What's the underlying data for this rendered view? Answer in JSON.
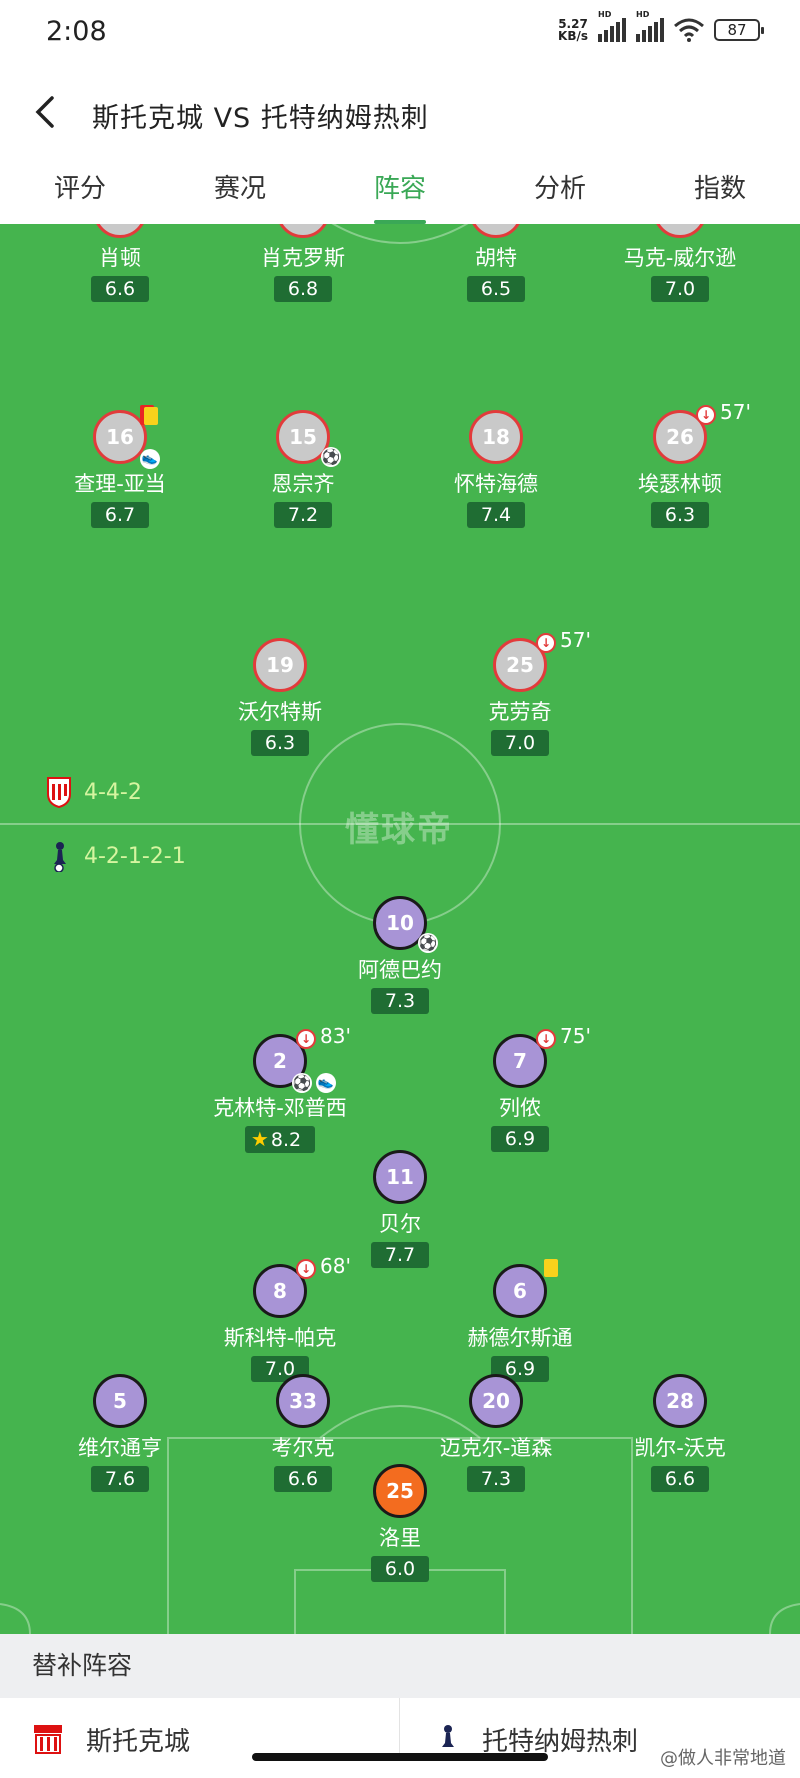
{
  "status": {
    "time": "2:08",
    "speed_value": "5.27",
    "speed_unit": "KB/s",
    "net1": "HD",
    "net2": "HD",
    "battery": "87"
  },
  "header": {
    "title": "斯托克城 VS 托特纳姆热刺"
  },
  "tabs": [
    {
      "label": "评分"
    },
    {
      "label": "赛况"
    },
    {
      "label": "阵容"
    },
    {
      "label": "分析"
    },
    {
      "label": "指数"
    }
  ],
  "active_tab": "阵容",
  "watermark": "懂球帝",
  "colors": {
    "accent": "#3aa856",
    "pitch": "#45b44e",
    "rating_bg": "#1f6d33"
  },
  "formations": {
    "home": "4-4-2",
    "away": "4-2-1-2-1"
  },
  "home_players": [
    {
      "name": "肖顿",
      "rating": "6.6"
    },
    {
      "name": "肖克罗斯",
      "rating": "6.8"
    },
    {
      "name": "胡特",
      "rating": "6.5"
    },
    {
      "name": "马克-威尔逊",
      "rating": "7.0"
    },
    {
      "number": "16",
      "name": "查理-亚当",
      "rating": "6.7"
    },
    {
      "number": "15",
      "name": "恩宗齐",
      "rating": "7.2"
    },
    {
      "number": "18",
      "name": "怀特海德",
      "rating": "7.4"
    },
    {
      "number": "26",
      "name": "埃瑟林顿",
      "rating": "6.3",
      "sub_minute": "57'"
    },
    {
      "number": "19",
      "name": "沃尔特斯",
      "rating": "6.3"
    },
    {
      "number": "25",
      "name": "克劳奇",
      "rating": "7.0",
      "sub_minute": "57'"
    }
  ],
  "away_players": [
    {
      "number": "10",
      "name": "阿德巴约",
      "rating": "7.3"
    },
    {
      "number": "2",
      "name": "克林特-邓普西",
      "rating": "8.2",
      "sub_minute": "83'"
    },
    {
      "number": "7",
      "name": "列侬",
      "rating": "6.9",
      "sub_minute": "75'"
    },
    {
      "number": "11",
      "name": "贝尔",
      "rating": "7.7"
    },
    {
      "number": "8",
      "name": "斯科特-帕克",
      "rating": "7.0",
      "sub_minute": "68'"
    },
    {
      "number": "6",
      "name": "赫德尔斯通",
      "rating": "6.9"
    },
    {
      "number": "5",
      "name": "维尔通亨",
      "rating": "7.6"
    },
    {
      "number": "33",
      "name": "考尔克",
      "rating": "6.6"
    },
    {
      "number": "20",
      "name": "迈克尔-道森",
      "rating": "7.3"
    },
    {
      "number": "28",
      "name": "凯尔-沃克",
      "rating": "6.6"
    },
    {
      "number": "25",
      "name": "洛里",
      "rating": "6.0"
    }
  ],
  "subs": {
    "title": "替补阵容",
    "home_team": "斯托克城",
    "away_team": "托特纳姆热刺"
  },
  "corner_watermark": "@做人非常地道"
}
